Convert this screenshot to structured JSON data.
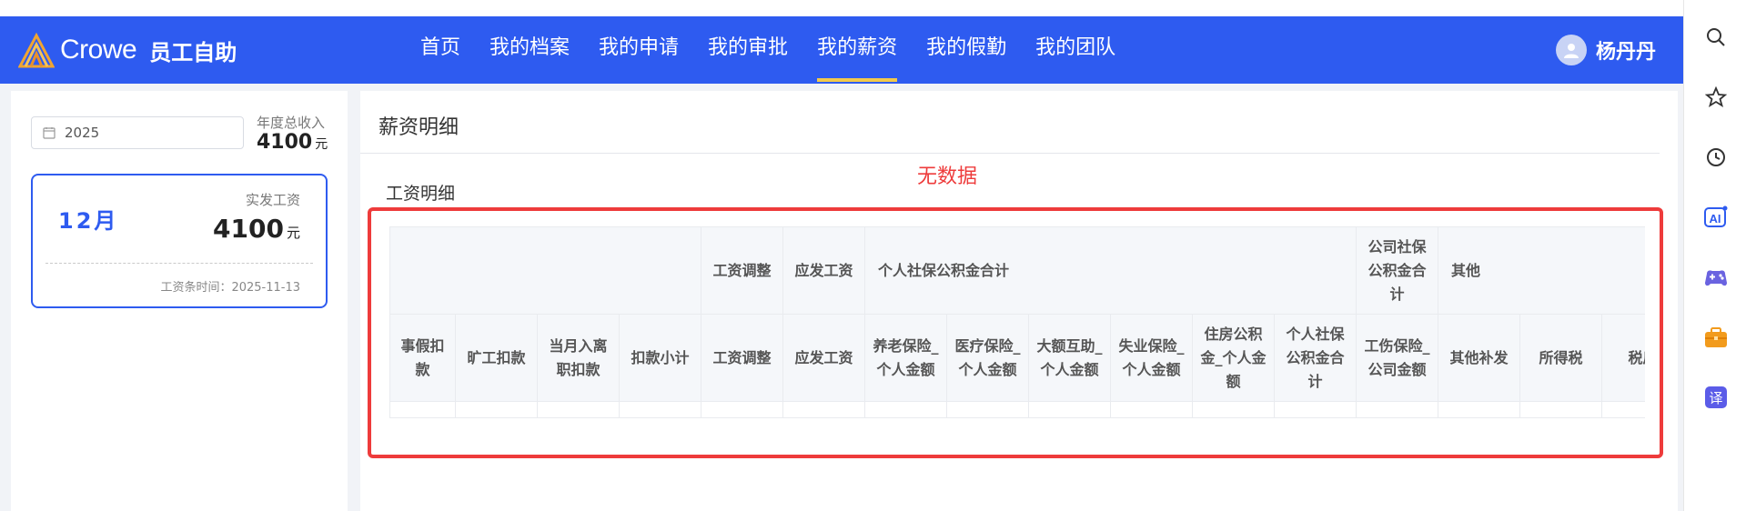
{
  "header": {
    "logo_text": "Crowe",
    "app_name": "员工自助",
    "nav": [
      "首页",
      "我的档案",
      "我的申请",
      "我的审批",
      "我的薪资",
      "我的假勤",
      "我的团队"
    ],
    "active_nav": "我的薪资",
    "user_name": "杨丹丹"
  },
  "left": {
    "year": "2025",
    "annual_income_label": "年度总收入",
    "annual_income_value": "4100",
    "currency_unit": "元",
    "month_card": {
      "month": "12月",
      "actual_label": "实发工资",
      "actual_value": "4100",
      "unit": "元",
      "slip_time": "工资条时间：2025-11-13"
    }
  },
  "main": {
    "title": "薪资明细",
    "no_data": "无数据",
    "section_title": "工资明细",
    "group_headers": [
      "工资调整",
      "应发工资",
      "个人社保公积金合计",
      "公司社保公积金合计",
      "其他"
    ],
    "columns": [
      "事假扣款",
      "旷工扣款",
      "当月入离职扣款",
      "扣款小计",
      "工资调整",
      "应发工资",
      "养老保险_个人金额",
      "医疗保险_个人金额",
      "大额互助_个人金额",
      "失业保险_个人金额",
      "住房公积金_个人金额",
      "个人社保公积金合计",
      "工伤保险_公司金额",
      "其他补发",
      "所得税",
      "税后"
    ]
  },
  "colors": {
    "brand": "#2e5bf0",
    "active_underline": "#f2c94c",
    "alert": "#ee3b3b"
  },
  "icons": [
    "search-icon",
    "star-icon",
    "history-icon",
    "ai-icon",
    "game-icon",
    "toolbox-icon",
    "translate-icon"
  ]
}
